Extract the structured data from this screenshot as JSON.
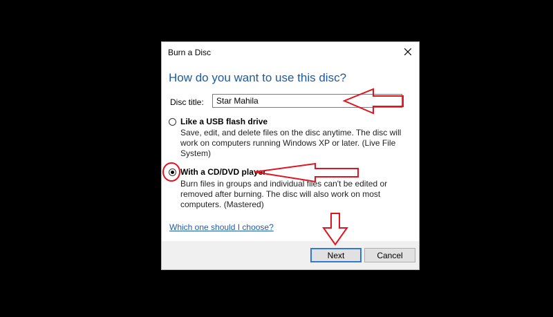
{
  "dialog": {
    "title": "Burn a Disc",
    "heading": "How do you want to use this disc?",
    "disc_title_label": "Disc title:",
    "disc_title_value": "Star Mahila",
    "options": [
      {
        "title": "Like a USB flash drive",
        "description": "Save, edit, and delete files on the disc anytime. The disc will work on computers running Windows XP or later. (Live File System)",
        "selected": false
      },
      {
        "title": "With a CD/DVD player",
        "description": "Burn files in groups and individual files can't be edited or removed after burning. The disc will also work on most computers. (Mastered)",
        "selected": true
      }
    ],
    "help_link": "Which one should I choose?",
    "next_label": "Next",
    "cancel_label": "Cancel"
  },
  "colors": {
    "heading": "#1c5aa6",
    "annotation": "#e0141e",
    "background": "#000000"
  },
  "icons": {
    "close": "close-icon"
  }
}
